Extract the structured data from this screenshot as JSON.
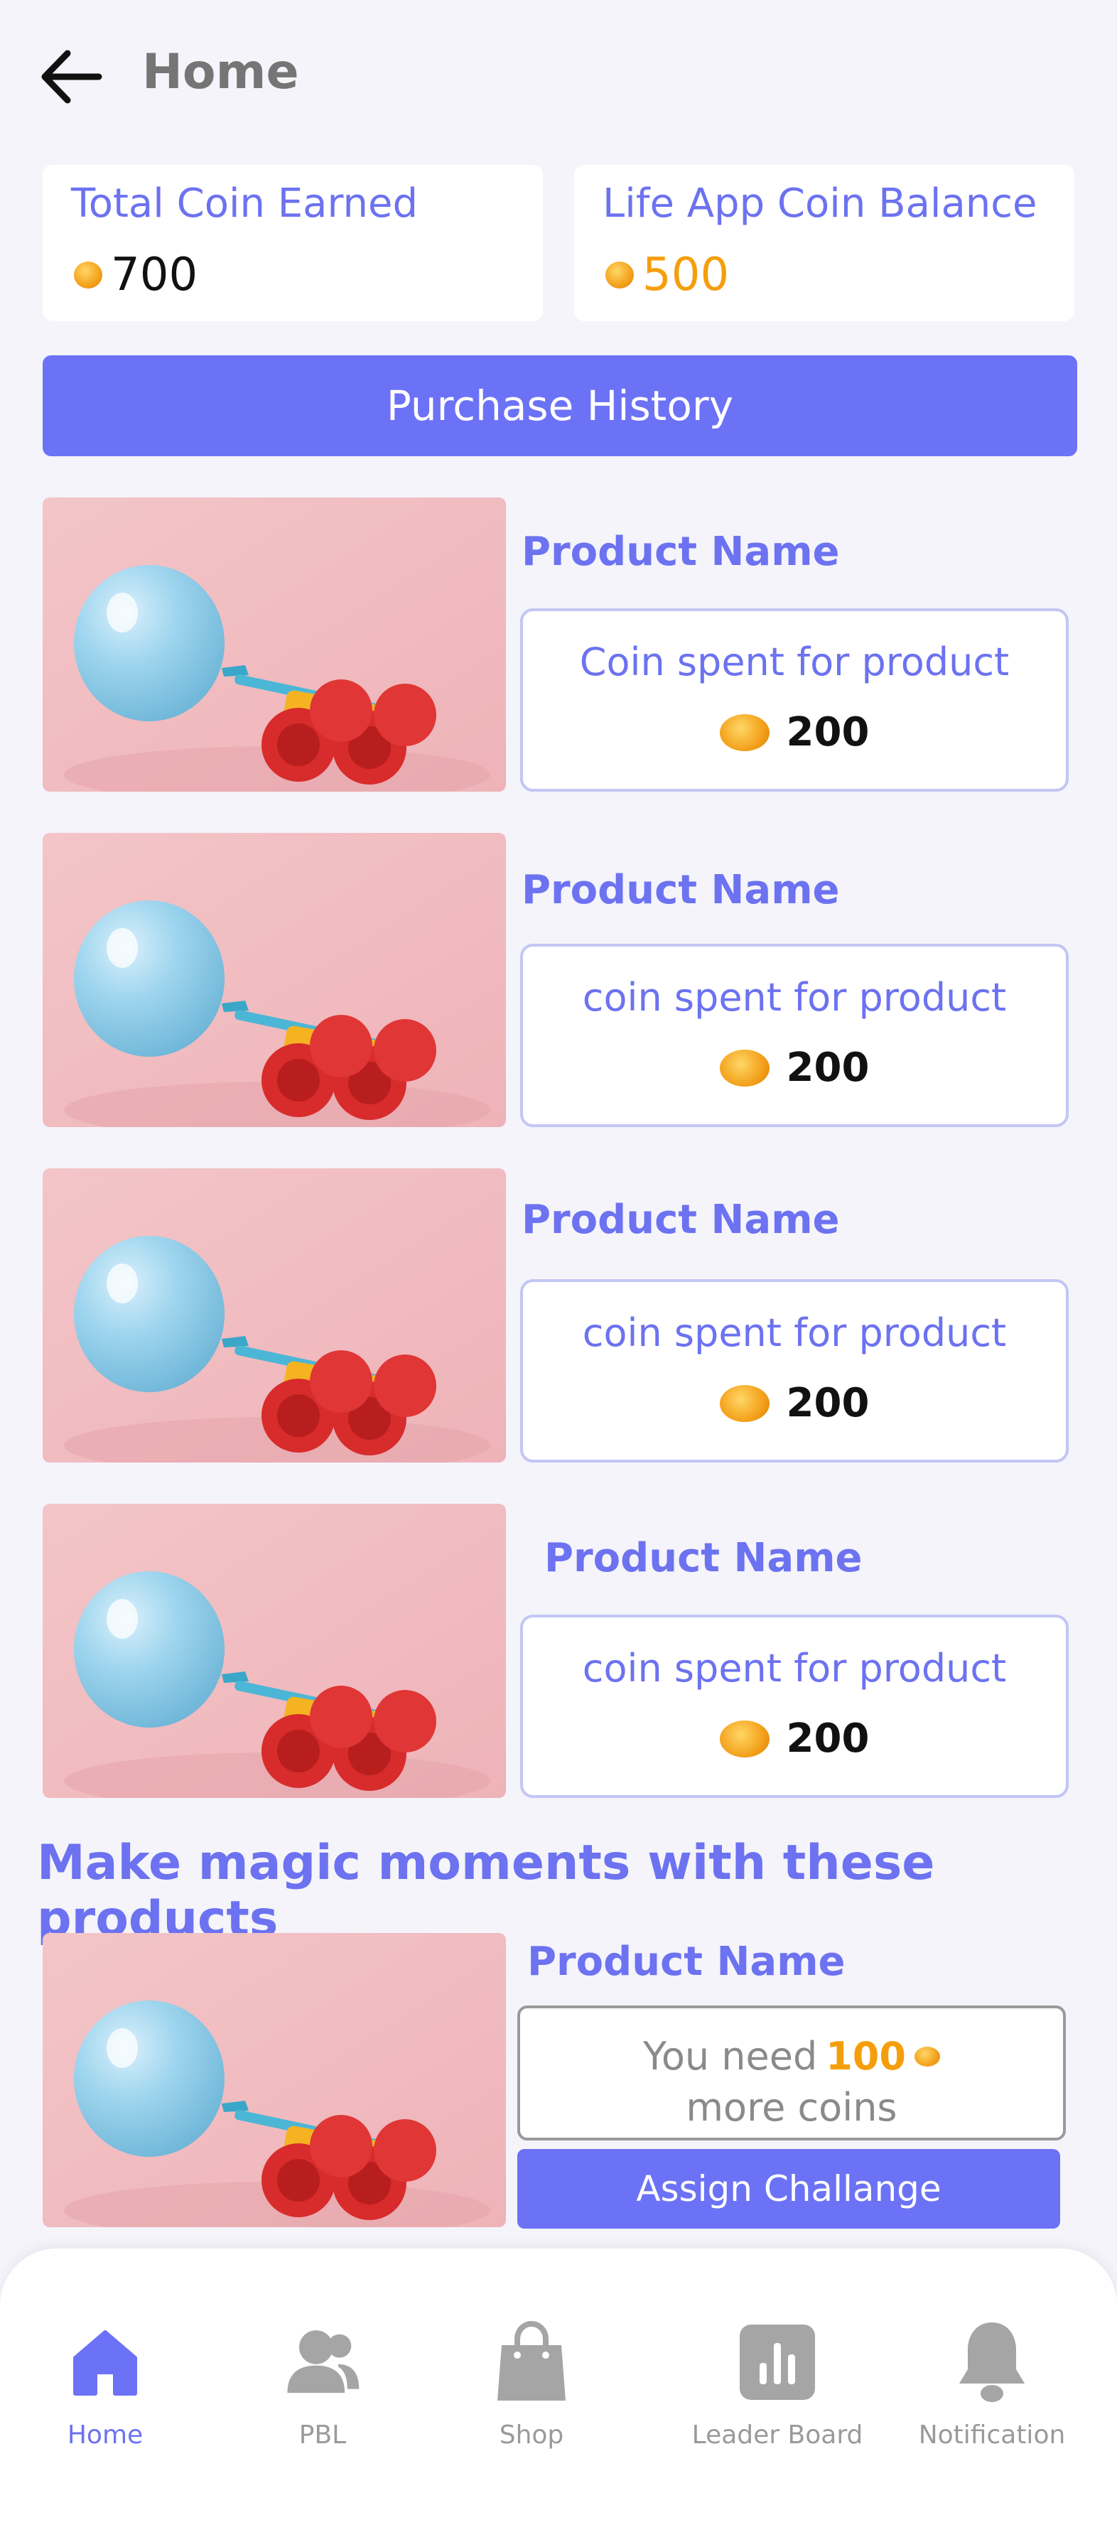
{
  "header": {
    "title": "Home"
  },
  "stats": {
    "total_coin_label": "Total Coin Earned",
    "total_coin_value": "700",
    "balance_label": "Life App Coin Balance",
    "balance_value": "500"
  },
  "purchase_history_label": "Purchase History",
  "purchased": [
    {
      "name": "Product Name",
      "spent_label": "Coin spent for product",
      "coins": "200"
    },
    {
      "name": "Product Name",
      "spent_label": "coin spent for product",
      "coins": "200"
    },
    {
      "name": "Product Name",
      "spent_label": "coin spent for product",
      "coins": "200"
    },
    {
      "name": "Product Name",
      "spent_label": "coin spent for product",
      "coins": "200"
    }
  ],
  "recommend": {
    "heading": "Make magic moments with these products",
    "name": "Product Name",
    "need_prefix": "You need",
    "need_amount": "100",
    "need_suffix": "more coins",
    "assign_label": "Assign Challange"
  },
  "nav": [
    {
      "label": "Home",
      "icon": "home-icon",
      "active": true
    },
    {
      "label": "PBL",
      "icon": "people-icon",
      "active": false
    },
    {
      "label": "Shop",
      "icon": "shopping-bag-icon",
      "active": false
    },
    {
      "label": "Leader Board",
      "icon": "bar-chart-icon",
      "active": false
    },
    {
      "label": "Notification",
      "icon": "bell-icon",
      "active": false
    }
  ],
  "colors": {
    "accent": "#6C72F5",
    "balance_orange": "#F59E0B",
    "nav_inactive": "#9A9A9A",
    "background": "#F4F4FA"
  }
}
